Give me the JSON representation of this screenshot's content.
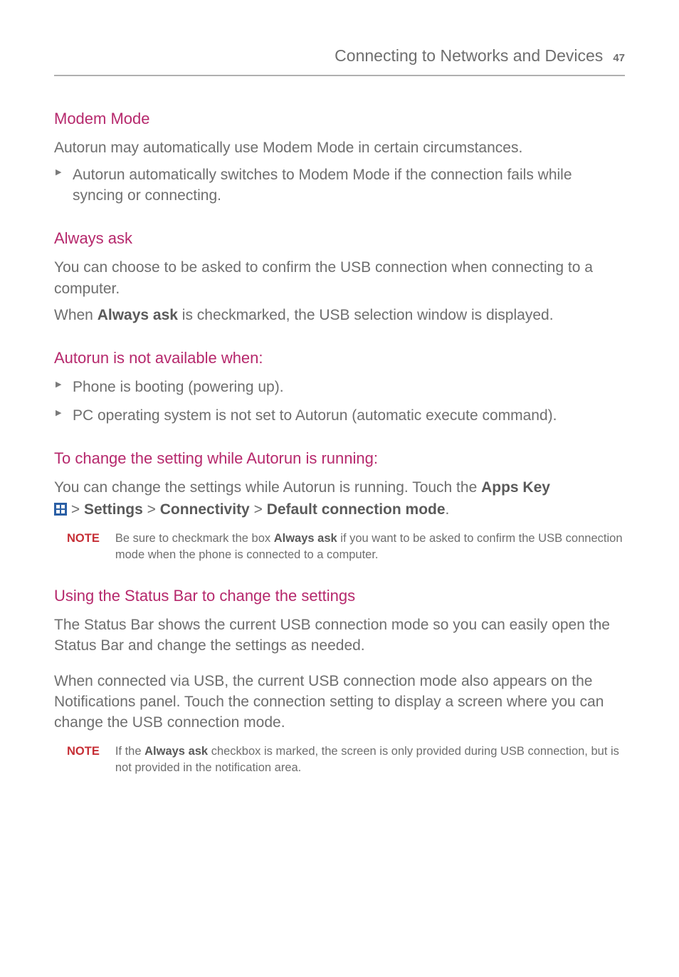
{
  "header": {
    "title": "Connecting to Networks and Devices",
    "page": "47"
  },
  "s1": {
    "heading": "Modem Mode",
    "p1": "Autorun may automatically use Modem Mode in certain circumstances.",
    "b1": "Autorun automatically switches to Modem Mode if the connection fails while syncing or connecting."
  },
  "s2": {
    "heading": "Always ask",
    "p1": "You can choose to be asked to confirm the USB connection when connecting to a computer.",
    "p2a": "When ",
    "p2b": "Always ask",
    "p2c": " is checkmarked, the USB selection window is displayed."
  },
  "s3": {
    "heading": "Autorun is not available when:",
    "b1": "Phone is booting (powering up).",
    "b2": "PC operating system is not set to Autorun (automatic execute command)."
  },
  "s4": {
    "heading": "To change the setting while Autorun is running:",
    "p1a": "You can change the settings while Autorun is running. Touch the ",
    "p1b": "Apps Key",
    "p2a": " > ",
    "p2b": "Settings",
    "p2c": " > ",
    "p2d": "Connectivity",
    "p2e": " > ",
    "p2f": "Default connection mode",
    "p2g": ".",
    "noteLabel": "NOTE",
    "note_a": "Be sure to checkmark the box ",
    "note_b": "Always ask",
    "note_c": " if you want to be asked to confirm the USB connection mode when the phone is connected to a computer."
  },
  "s5": {
    "heading": "Using the Status Bar to change the settings",
    "p1": "The Status Bar shows the current USB connection mode so you can easily open the Status Bar and change the settings as needed.",
    "p2": "When connected via USB, the current USB connection mode also appears on the Notifications panel. Touch the connection setting to display a screen where you can change the USB connection mode.",
    "noteLabel": "NOTE",
    "note_a": "If the ",
    "note_b": "Always ask",
    "note_c": " checkbox is marked, the screen is only provided during USB connection, but is not provided in the notification area."
  }
}
